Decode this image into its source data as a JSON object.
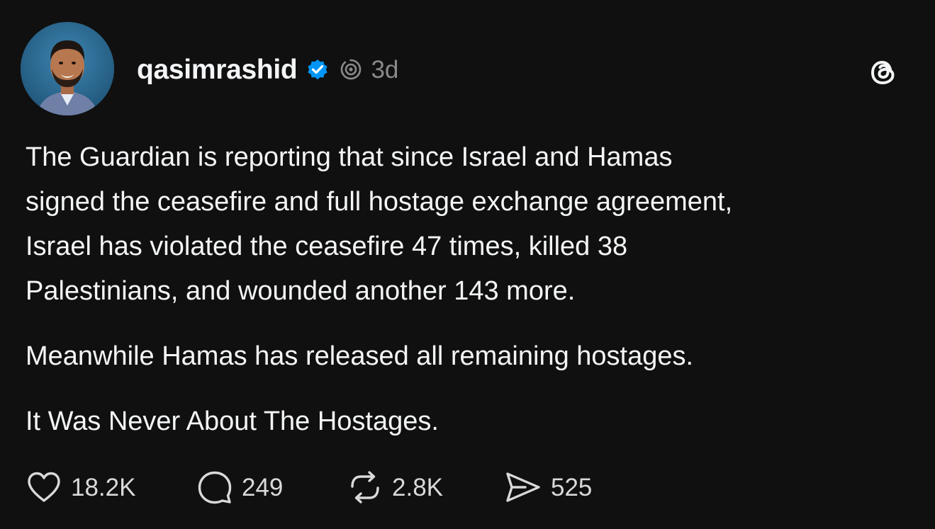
{
  "author": {
    "username": "qasimrashid",
    "verified_icon": "verified-badge-icon",
    "fediverse_icon": "fediverse-icon",
    "timestamp": "3d",
    "avatar_icon": "avatar"
  },
  "app": {
    "logo_icon": "threads-logo-icon"
  },
  "post": {
    "paragraph_1": "The Guardian is reporting that since Israel and Hamas\nsigned the ceasefire and full hostage exchange agreement,\nIsrael has violated the ceasefire 47 times, killed 38\nPalestinians, and wounded another 143 more.",
    "paragraph_2": "Meanwhile Hamas has released all remaining hostages.",
    "paragraph_3": "It Was Never About The Hostages."
  },
  "actions": {
    "likes": "18.2K",
    "replies": "249",
    "reposts": "2.8K",
    "shares": "525"
  },
  "colors": {
    "background": "#101010",
    "text": "#f3f5f7",
    "muted": "#8a8a8a",
    "verified_blue": "#0095f6"
  }
}
